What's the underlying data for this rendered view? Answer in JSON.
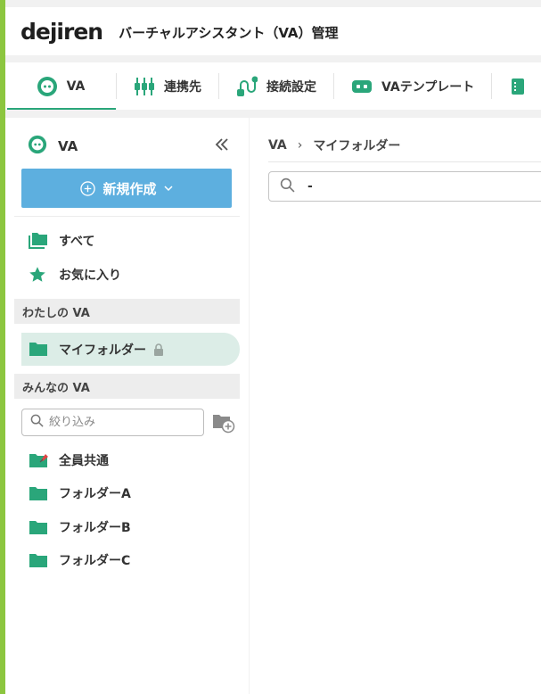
{
  "header": {
    "logo": "dejiren",
    "title": "バーチャルアシスタント（VA）管理"
  },
  "tabs": [
    {
      "label": "VA",
      "icon": "va-icon",
      "active": true
    },
    {
      "label": "連携先",
      "icon": "integration-icon",
      "active": false
    },
    {
      "label": "接続設定",
      "icon": "connection-icon",
      "active": false
    },
    {
      "label": "VAテンプレート",
      "icon": "template-icon",
      "active": false
    }
  ],
  "sidebar": {
    "title": "VA",
    "new_button": "新規作成",
    "nav": [
      {
        "label": "すべて",
        "icon": "folders-icon"
      },
      {
        "label": "お気に入り",
        "icon": "star-icon"
      }
    ],
    "my_section": "わたしの VA",
    "my_folder": "マイフォルダー",
    "shared_section": "みんなの VA",
    "filter_placeholder": "絞り込み",
    "shared_folders": [
      {
        "label": "全員共通",
        "icon": "pinned-folder-icon"
      },
      {
        "label": "フォルダーA",
        "icon": "folder-icon"
      },
      {
        "label": "フォルダーB",
        "icon": "folder-icon"
      },
      {
        "label": "フォルダーC",
        "icon": "folder-icon"
      }
    ]
  },
  "main": {
    "breadcrumb": [
      "VA",
      "マイフォルダー"
    ],
    "breadcrumb_separator": "›",
    "search_value": "-"
  },
  "colors": {
    "accent_green": "#2aa67a",
    "primary_button": "#5dafdf",
    "left_bar": "#8cc63f",
    "selected_bg": "#dcede7"
  }
}
